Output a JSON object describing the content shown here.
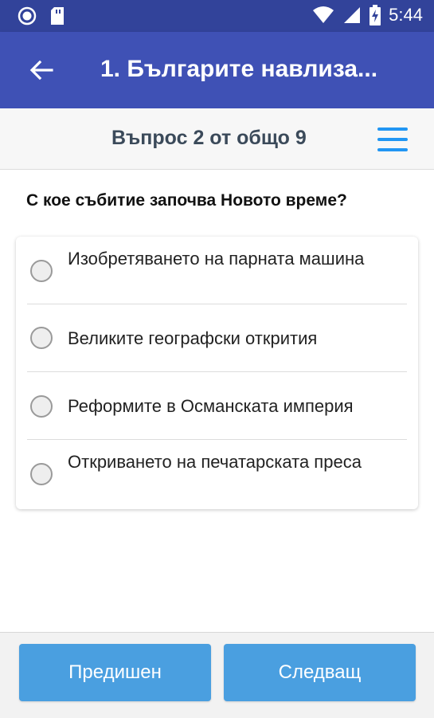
{
  "status_bar": {
    "time": "5:44",
    "icons": [
      "record-icon",
      "sd-card-icon",
      "wifi-icon",
      "signal-icon",
      "battery-charging-icon"
    ]
  },
  "app_bar": {
    "back_icon": "arrow-left-icon",
    "title": "1. Българите навлиза..."
  },
  "question_header": {
    "counter": "Въпрос 2 от общо 9",
    "menu_icon": "hamburger-menu-icon"
  },
  "question": {
    "text": "С кое събитие започва Новото време?"
  },
  "answers": [
    {
      "label": "Изобретяването на парната машина",
      "selected": false
    },
    {
      "label": "Великите географски открития",
      "selected": false
    },
    {
      "label": "Реформите в Османската империя",
      "selected": false
    },
    {
      "label": "Откриването на печатарската преса",
      "selected": false
    }
  ],
  "bottom_nav": {
    "previous": "Предишен",
    "next": "Следващ"
  },
  "colors": {
    "status_bar": "#32439a",
    "app_bar": "#3f51b5",
    "accent": "#2196f3",
    "button": "#4a9fe0"
  }
}
